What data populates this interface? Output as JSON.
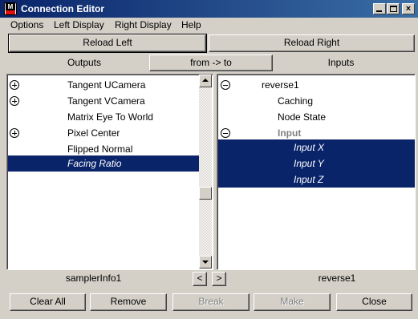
{
  "window": {
    "title": "Connection Editor",
    "app_icon": "maya-app-icon",
    "controls": {
      "minimize": "_",
      "maximize": "□",
      "close": "×"
    }
  },
  "menu": [
    "Options",
    "Left Display",
    "Right Display",
    "Help"
  ],
  "reload": {
    "left": "Reload Left",
    "right": "Reload Right"
  },
  "headers": {
    "outputs": "Outputs",
    "direction": "from -> to",
    "inputs": "Inputs"
  },
  "left_list": [
    {
      "label": "Tangent UCamera",
      "expandable": true,
      "selected": false
    },
    {
      "label": "Tangent VCamera",
      "expandable": true,
      "selected": false
    },
    {
      "label": "Matrix Eye To World",
      "expandable": false,
      "selected": false
    },
    {
      "label": "Pixel Center",
      "expandable": true,
      "selected": false
    },
    {
      "label": "Flipped Normal",
      "expandable": false,
      "selected": false
    },
    {
      "label": "Facing Ratio",
      "expandable": false,
      "selected": true
    }
  ],
  "right_list": [
    {
      "label": "reverse1",
      "expandable": "collapse",
      "selected": false
    },
    {
      "label": "Caching",
      "selected": false
    },
    {
      "label": "Node State",
      "selected": false
    },
    {
      "label": "Input",
      "expandable": "collapse",
      "selected": false
    },
    {
      "label": "Input X",
      "selected": true
    },
    {
      "label": "Input Y",
      "selected": true
    },
    {
      "label": "Input Z",
      "selected": true
    }
  ],
  "nodes": {
    "left": "samplerInfo1",
    "right": "reverse1",
    "prev": "<",
    "next": ">"
  },
  "footer": {
    "clear_all": "Clear All",
    "remove": "Remove",
    "break": "Break",
    "make": "Make",
    "close": "Close"
  },
  "colors": {
    "selection": "#0a246a",
    "face": "#d4d0c8",
    "title_start": "#0a246a",
    "title_end": "#3a6ea5"
  }
}
